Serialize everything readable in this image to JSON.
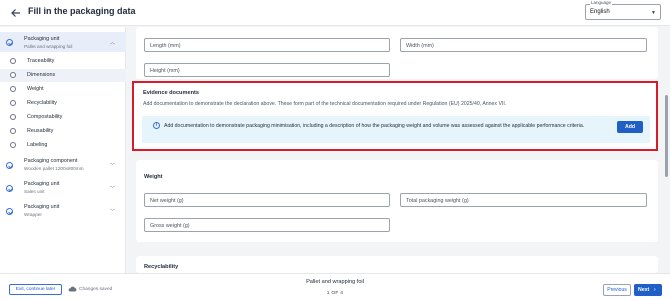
{
  "header": {
    "title": "Fill in the packaging data",
    "language_label": "Language",
    "language_value": "English"
  },
  "sidebar": {
    "groups": [
      {
        "title": "Packaging unit",
        "subtitle": "Pallet and wrapping foil",
        "expanded": true,
        "completed": true
      },
      {
        "title": "Packaging component",
        "subtitle": "Wooden pallet 1200x800mm",
        "expanded": false,
        "completed": true
      },
      {
        "title": "Packaging unit",
        "subtitle": "Sales unit",
        "expanded": false,
        "completed": true
      },
      {
        "title": "Packaging unit",
        "subtitle": "Wrapper",
        "expanded": false,
        "completed": true
      }
    ],
    "items": [
      {
        "label": "Traceability"
      },
      {
        "label": "Dimensions"
      },
      {
        "label": "Weight"
      },
      {
        "label": "Recyclability"
      },
      {
        "label": "Compostability"
      },
      {
        "label": "Reusability"
      },
      {
        "label": "Labeling"
      }
    ],
    "active_item": "Dimensions"
  },
  "dimensions": {
    "length_label": "Length (mm)",
    "width_label": "Width (mm)",
    "height_label": "Height (mm)"
  },
  "evidence": {
    "title": "Evidence documents",
    "description": "Add documentation to demonstrate the declaration above. These form part of the technical documentation required under Regulation (EU) 2025/40, Annex VII.",
    "info_text": "Add documentation to demonstrate packaging minimisation, including a description of how the packaging weight and volume was assessed against the applicable performance criteria.",
    "add_label": "Add"
  },
  "weight": {
    "title": "Weight",
    "net_label": "Net weight (g)",
    "total_label": "Total packaging weight (g)",
    "gross_label": "Gross weight (g)"
  },
  "recyclability": {
    "title": "Recyclability"
  },
  "footer": {
    "exit_label": "Exit, continue later",
    "saved_label": "Changes saved",
    "package_name": "Pallet and wrapping foil",
    "pager": "1 OF 4",
    "previous_label": "Previous",
    "next_label": "Next"
  },
  "colors": {
    "accent": "#1f5fc6",
    "highlight": "#d81b2b",
    "info_bg": "#e6f4fb"
  }
}
